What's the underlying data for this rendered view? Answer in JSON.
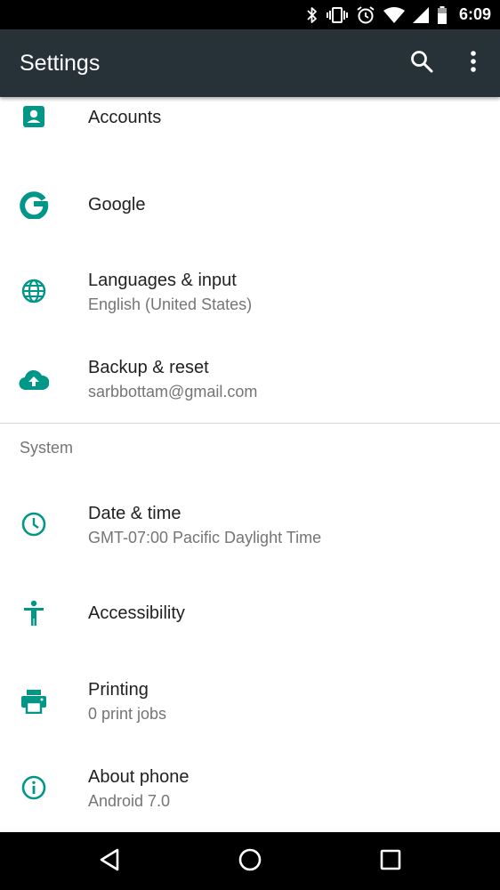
{
  "status_bar": {
    "time": "6:09",
    "icons": [
      "bluetooth-icon",
      "vibrate-icon",
      "alarm-icon",
      "wifi-icon",
      "signal-icon",
      "battery-icon"
    ]
  },
  "app_bar": {
    "title": "Settings",
    "actions": [
      "search-icon",
      "more-vert-icon"
    ]
  },
  "accent_color": "#009688",
  "app_bar_color": "#263238",
  "items_top": [
    {
      "title": "Accounts",
      "summary": "",
      "icon": "account-box-icon"
    },
    {
      "title": "Google",
      "summary": "",
      "icon": "google-icon"
    },
    {
      "title": "Languages & input",
      "summary": "English (United States)",
      "icon": "language-globe-icon"
    },
    {
      "title": "Backup & reset",
      "summary": "sarbbottam@gmail.com",
      "icon": "cloud-upload-icon"
    }
  ],
  "system_category": {
    "label": "System",
    "items": [
      {
        "title": "Date & time",
        "summary": "GMT-07:00 Pacific Daylight Time",
        "icon": "clock-icon"
      },
      {
        "title": "Accessibility",
        "summary": "",
        "icon": "accessibility-icon"
      },
      {
        "title": "Printing",
        "summary": "0 print jobs",
        "icon": "printer-icon"
      },
      {
        "title": "About phone",
        "summary": "Android 7.0",
        "icon": "info-icon"
      }
    ]
  },
  "nav_bar": {
    "buttons": [
      "back-icon",
      "home-icon",
      "recents-icon"
    ]
  }
}
